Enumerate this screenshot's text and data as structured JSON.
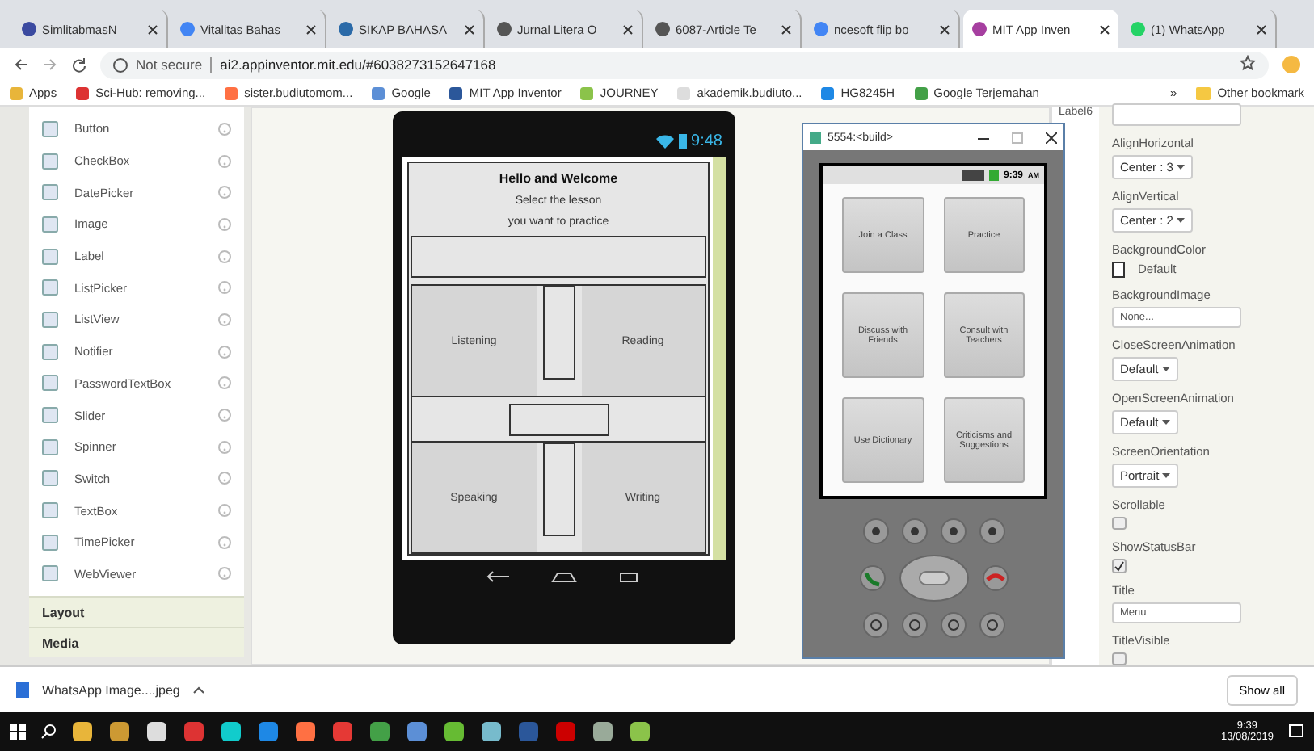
{
  "browser": {
    "tabs": [
      {
        "title": "SimlitabmasN",
        "selected": false
      },
      {
        "title": "Vitalitas Bahas",
        "selected": false
      },
      {
        "title": "SIKAP BAHASA",
        "selected": false
      },
      {
        "title": "Jurnal Litera O",
        "selected": false
      },
      {
        "title": "6087-Article Te",
        "selected": false
      },
      {
        "title": "ncesoft flip bo",
        "selected": false
      },
      {
        "title": "MIT App Inven",
        "selected": true
      },
      {
        "title": "(1) WhatsApp",
        "selected": false
      }
    ],
    "security": "Not secure",
    "url": "ai2.appinventor.mit.edu/#6038273152647168",
    "bookmarks": [
      "Apps",
      "Sci-Hub: removing...",
      "sister.budiutomom...",
      "Google",
      "MIT App Inventor",
      "JOURNEY",
      "akademik.budiuto...",
      "HG8245H",
      "Google Terjemahan"
    ],
    "overflow": "»",
    "other_bookmarks": "Other bookmark"
  },
  "palette": {
    "items": [
      "Button",
      "CheckBox",
      "DatePicker",
      "Image",
      "Label",
      "ListPicker",
      "ListView",
      "Notifier",
      "PasswordTextBox",
      "Slider",
      "Spinner",
      "Switch",
      "TextBox",
      "TimePicker",
      "WebViewer"
    ],
    "sections": [
      "Layout",
      "Media"
    ]
  },
  "viewer": {
    "status_time": "9:48",
    "title": "Hello and Welcome",
    "subtitle_lines": [
      "Select the lesson",
      "you want to practice"
    ],
    "lessons": [
      [
        "Listening",
        "Reading"
      ],
      [
        "Speaking",
        "Writing"
      ]
    ]
  },
  "components": {
    "visible_item": "Label6"
  },
  "emulator": {
    "title": "5554:<build>",
    "status_time": "9:39",
    "status_ampm": "AM",
    "buttons": [
      "Join a Class",
      "Practice",
      "Discuss with Friends",
      "Consult with Teachers",
      "Use Dictionary",
      "Criticisms and Suggestions"
    ]
  },
  "properties": [
    {
      "kind": "select",
      "label": "AlignHorizontal",
      "value": "Center : 3"
    },
    {
      "kind": "select",
      "label": "AlignVertical",
      "value": "Center : 2"
    },
    {
      "kind": "color",
      "label": "BackgroundColor",
      "value": "Default"
    },
    {
      "kind": "text",
      "label": "BackgroundImage",
      "value": "None..."
    },
    {
      "kind": "select",
      "label": "CloseScreenAnimation",
      "value": "Default"
    },
    {
      "kind": "select",
      "label": "OpenScreenAnimation",
      "value": "Default"
    },
    {
      "kind": "select",
      "label": "ScreenOrientation",
      "value": "Portrait"
    },
    {
      "kind": "checkbox",
      "label": "Scrollable",
      "checked": false
    },
    {
      "kind": "checkbox",
      "label": "ShowStatusBar",
      "checked": true
    },
    {
      "kind": "text",
      "label": "Title",
      "value": "Menu"
    },
    {
      "kind": "checkbox",
      "label": "TitleVisible",
      "checked": false
    }
  ],
  "download": {
    "file": "WhatsApp Image....jpeg",
    "show_all": "Show all"
  },
  "taskbar": {
    "time": "9:39",
    "date": "13/08/2019"
  }
}
